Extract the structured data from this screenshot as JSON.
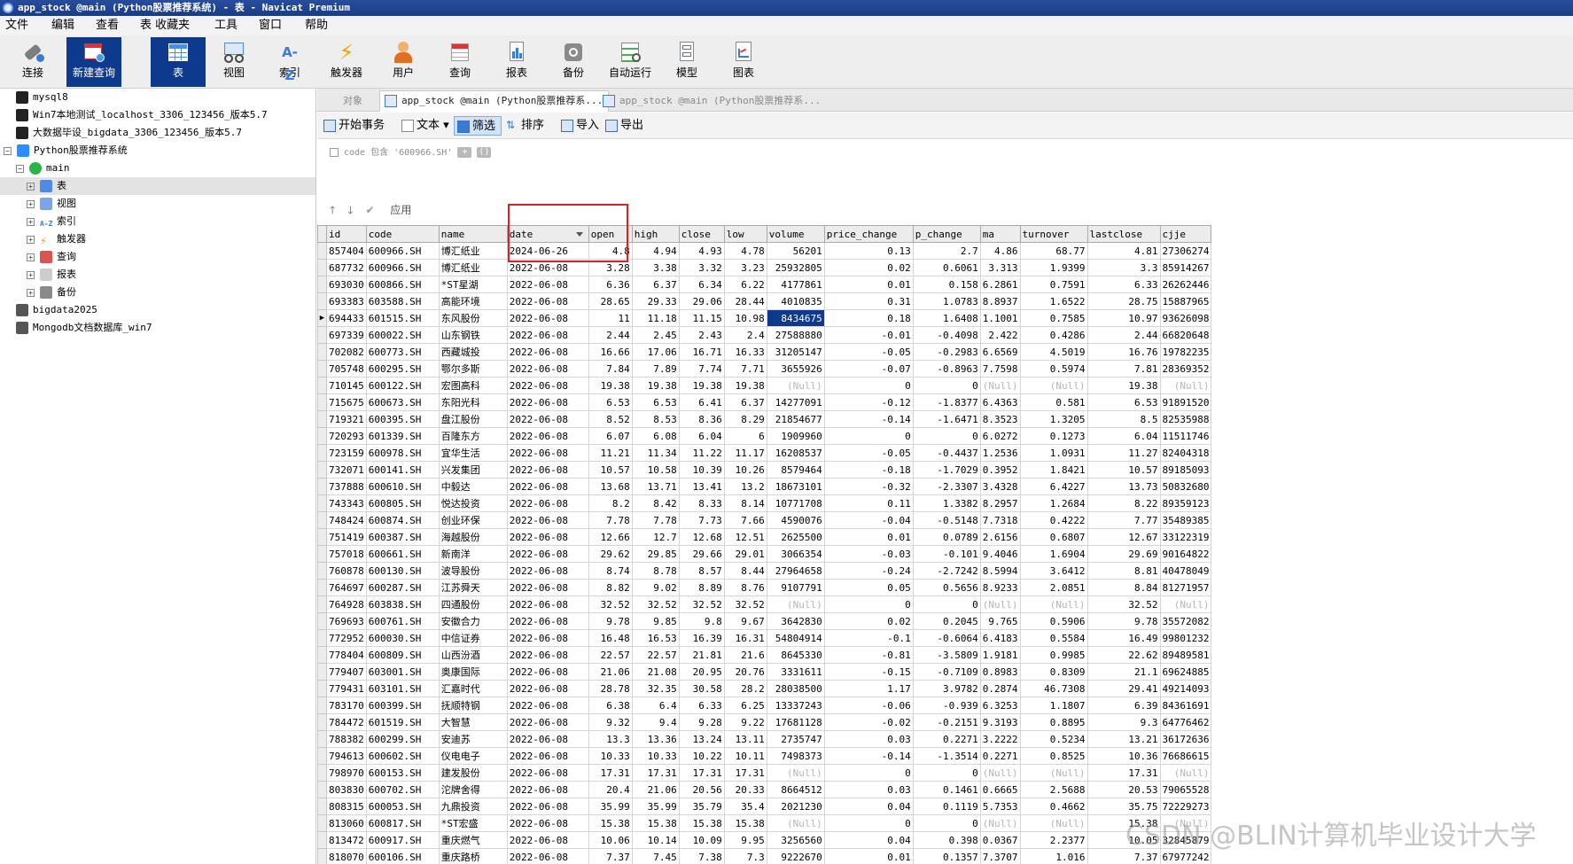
{
  "window": {
    "title": "app_stock @main (Python股票推荐系统) - 表 - Navicat Premium"
  },
  "menu": [
    "文件",
    "编辑",
    "查看",
    "表 收藏夹",
    "工具",
    "窗口",
    "帮助"
  ],
  "toolbar": [
    {
      "label": "连接",
      "icon": "plug-icon"
    },
    {
      "label": "新建查询",
      "icon": "new-query-icon"
    },
    {
      "label": "表",
      "icon": "table-icon"
    },
    {
      "label": "视图",
      "icon": "view-icon"
    },
    {
      "label": "索引",
      "icon": "index-icon"
    },
    {
      "label": "触发器",
      "icon": "lightning-icon"
    },
    {
      "label": "用户",
      "icon": "user-icon"
    },
    {
      "label": "查询",
      "icon": "query-icon"
    },
    {
      "label": "报表",
      "icon": "report-icon"
    },
    {
      "label": "备份",
      "icon": "backup-icon"
    },
    {
      "label": "自动运行",
      "icon": "schedule-icon"
    },
    {
      "label": "模型",
      "icon": "model-icon"
    },
    {
      "label": "图表",
      "icon": "chart-icon"
    }
  ],
  "tree": [
    {
      "label": "mysql8"
    },
    {
      "label": "Win7本地测试_localhost_3306_123456_版本5.7"
    },
    {
      "label": "大数据毕设_bigdata_3306_123456_版本5.7"
    },
    {
      "label": "Python股票推荐系统"
    },
    {
      "label": "main"
    },
    {
      "label": "表"
    },
    {
      "label": "视图"
    },
    {
      "label": "索引"
    },
    {
      "label": "触发器"
    },
    {
      "label": "查询"
    },
    {
      "label": "报表"
    },
    {
      "label": "备份"
    },
    {
      "label": "bigdata2025"
    },
    {
      "label": "Mongodb文档数据库_win7"
    }
  ],
  "tabs": [
    "对象",
    "app_stock @main (Python股票推荐系...",
    "app_stock @main (Python股票推荐系..."
  ],
  "object_toolbar": [
    "开始事务",
    "文本",
    "筛选",
    "排序",
    "导入",
    "导出"
  ],
  "filter": {
    "condition": "code 包含 '600966.SH'",
    "apply": "应用"
  },
  "columns": [
    "id",
    "code",
    "name",
    "date",
    "open",
    "high",
    "close",
    "low",
    "volume",
    "price_change",
    "p_change",
    "ma",
    "turnover",
    "lastclose",
    "cjje"
  ],
  "rows": [
    [
      "857404",
      "600966.SH",
      "博汇纸业",
      "2024-06-26",
      "4.8",
      "4.94",
      "4.93",
      "4.78",
      "56201",
      "0.13",
      "2.7",
      "4.86",
      "68.77",
      "4.81",
      "27306274"
    ],
    [
      "687732",
      "600966.SH",
      "博汇纸业",
      "2022-06-08",
      "3.28",
      "3.38",
      "3.32",
      "3.23",
      "25932805",
      "0.02",
      "0.6061",
      "3.313",
      "1.9399",
      "3.3",
      "85914267"
    ],
    [
      "693030",
      "600866.SH",
      "*ST星湖",
      "2022-06-08",
      "6.36",
      "6.37",
      "6.34",
      "6.22",
      "4177861",
      "0.01",
      "0.158",
      "6.2861",
      "0.7591",
      "6.33",
      "26262446"
    ],
    [
      "693383",
      "603588.SH",
      "高能环境",
      "2022-06-08",
      "28.65",
      "29.33",
      "29.06",
      "28.44",
      "4010835",
      "0.31",
      "1.0783",
      "8.8937",
      "1.6522",
      "28.75",
      "15887965"
    ],
    [
      "694433",
      "601515.SH",
      "东风股份",
      "2022-06-08",
      "11",
      "11.18",
      "11.15",
      "10.98",
      "8434675",
      "0.18",
      "1.6408",
      "1.1001",
      "0.7585",
      "10.97",
      "93626098"
    ],
    [
      "697339",
      "600022.SH",
      "山东钢铁",
      "2022-06-08",
      "2.44",
      "2.45",
      "2.43",
      "2.4",
      "27588880",
      "-0.01",
      "-0.4098",
      "2.422",
      "0.4286",
      "2.44",
      "66820648"
    ],
    [
      "702082",
      "600773.SH",
      "西藏城投",
      "2022-06-08",
      "16.66",
      "17.06",
      "16.71",
      "16.33",
      "31205147",
      "-0.05",
      "-0.2983",
      "6.6569",
      "4.5019",
      "16.76",
      "19782235"
    ],
    [
      "705748",
      "600295.SH",
      "鄂尔多斯",
      "2022-06-08",
      "7.84",
      "7.89",
      "7.74",
      "7.71",
      "3655926",
      "-0.07",
      "-0.8963",
      "7.7598",
      "0.5974",
      "7.81",
      "28369352"
    ],
    [
      "710145",
      "600122.SH",
      "宏图高科",
      "2022-06-08",
      "19.38",
      "19.38",
      "19.38",
      "19.38",
      "(Null)",
      "0",
      "0",
      "(Null)",
      "(Null)",
      "19.38",
      "(Null)"
    ],
    [
      "715675",
      "600673.SH",
      "东阳光科",
      "2022-06-08",
      "6.53",
      "6.53",
      "6.41",
      "6.37",
      "14277091",
      "-0.12",
      "-1.8377",
      "6.4363",
      "0.581",
      "6.53",
      "91891520"
    ],
    [
      "719321",
      "600395.SH",
      "盘江股份",
      "2022-06-08",
      "8.52",
      "8.53",
      "8.36",
      "8.29",
      "21854677",
      "-0.14",
      "-1.6471",
      "8.3523",
      "1.3205",
      "8.5",
      "82535988"
    ],
    [
      "720293",
      "601339.SH",
      "百隆东方",
      "2022-06-08",
      "6.07",
      "6.08",
      "6.04",
      "6",
      "1909960",
      "0",
      "0",
      "6.0272",
      "0.1273",
      "6.04",
      "11511746"
    ],
    [
      "723159",
      "600978.SH",
      "宜华生活",
      "2022-06-08",
      "11.21",
      "11.34",
      "11.22",
      "11.17",
      "16208537",
      "-0.05",
      "-0.4437",
      "1.2536",
      "1.0931",
      "11.27",
      "82404318"
    ],
    [
      "732071",
      "600141.SH",
      "兴发集团",
      "2022-06-08",
      "10.57",
      "10.58",
      "10.39",
      "10.26",
      "8579464",
      "-0.18",
      "-1.7029",
      "0.3952",
      "1.8421",
      "10.57",
      "89185093"
    ],
    [
      "737888",
      "600610.SH",
      "中毅达",
      "2022-06-08",
      "13.68",
      "13.71",
      "13.41",
      "13.2",
      "18673101",
      "-0.32",
      "-2.3307",
      "3.4328",
      "6.4227",
      "13.73",
      "50832680"
    ],
    [
      "743343",
      "600805.SH",
      "悦达投资",
      "2022-06-08",
      "8.2",
      "8.42",
      "8.33",
      "8.14",
      "10771708",
      "0.11",
      "1.3382",
      "8.2957",
      "1.2684",
      "8.22",
      "89359123"
    ],
    [
      "748424",
      "600874.SH",
      "创业环保",
      "2022-06-08",
      "7.78",
      "7.78",
      "7.73",
      "7.66",
      "4590076",
      "-0.04",
      "-0.5148",
      "7.7318",
      "0.4222",
      "7.77",
      "35489385"
    ],
    [
      "751419",
      "600387.SH",
      "海越股份",
      "2022-06-08",
      "12.66",
      "12.7",
      "12.68",
      "12.51",
      "2625500",
      "0.01",
      "0.0789",
      "2.6156",
      "0.6807",
      "12.67",
      "33122319"
    ],
    [
      "757018",
      "600661.SH",
      "新南洋",
      "2022-06-08",
      "29.62",
      "29.85",
      "29.66",
      "29.01",
      "3066354",
      "-0.03",
      "-0.101",
      "9.4046",
      "1.6904",
      "29.69",
      "90164822"
    ],
    [
      "760878",
      "600130.SH",
      "波导股份",
      "2022-06-08",
      "8.74",
      "8.78",
      "8.57",
      "8.44",
      "27964658",
      "-0.24",
      "-2.7242",
      "8.5994",
      "3.6412",
      "8.81",
      "40478049"
    ],
    [
      "764697",
      "600287.SH",
      "江苏舜天",
      "2022-06-08",
      "8.82",
      "9.02",
      "8.89",
      "8.76",
      "9107791",
      "0.05",
      "0.5656",
      "8.9233",
      "2.0851",
      "8.84",
      "81271957"
    ],
    [
      "764928",
      "603838.SH",
      "四通股份",
      "2022-06-08",
      "32.52",
      "32.52",
      "32.52",
      "32.52",
      "(Null)",
      "0",
      "0",
      "(Null)",
      "(Null)",
      "32.52",
      "(Null)"
    ],
    [
      "769693",
      "600761.SH",
      "安徽合力",
      "2022-06-08",
      "9.78",
      "9.85",
      "9.8",
      "9.67",
      "3642830",
      "0.02",
      "0.2045",
      "9.765",
      "0.5906",
      "9.78",
      "35572082"
    ],
    [
      "772952",
      "600030.SH",
      "中信证券",
      "2022-06-08",
      "16.48",
      "16.53",
      "16.39",
      "16.31",
      "54804914",
      "-0.1",
      "-0.6064",
      "6.4183",
      "0.5584",
      "16.49",
      "99801232"
    ],
    [
      "778404",
      "600809.SH",
      "山西汾酒",
      "2022-06-08",
      "22.57",
      "22.57",
      "21.81",
      "21.6",
      "8645330",
      "-0.81",
      "-3.5809",
      "1.9181",
      "0.9985",
      "22.62",
      "89489581"
    ],
    [
      "779407",
      "603001.SH",
      "奥康国际",
      "2022-06-08",
      "21.06",
      "21.08",
      "20.95",
      "20.76",
      "3331611",
      "-0.15",
      "-0.7109",
      "0.8983",
      "0.8309",
      "21.1",
      "69624885"
    ],
    [
      "779431",
      "603101.SH",
      "汇嘉时代",
      "2022-06-08",
      "28.78",
      "32.35",
      "30.58",
      "28.2",
      "28038500",
      "1.17",
      "3.9782",
      "0.2874",
      "46.7308",
      "29.41",
      "49214093"
    ],
    [
      "783170",
      "600399.SH",
      "抚顺特钢",
      "2022-06-08",
      "6.38",
      "6.4",
      "6.33",
      "6.25",
      "13337243",
      "-0.06",
      "-0.939",
      "6.3253",
      "1.1807",
      "6.39",
      "84361691"
    ],
    [
      "784472",
      "601519.SH",
      "大智慧",
      "2022-06-08",
      "9.32",
      "9.4",
      "9.28",
      "9.22",
      "17681128",
      "-0.02",
      "-0.2151",
      "9.3193",
      "0.8895",
      "9.3",
      "64776462"
    ],
    [
      "788382",
      "600299.SH",
      "安迪苏",
      "2022-06-08",
      "13.3",
      "13.36",
      "13.24",
      "13.11",
      "2735747",
      "0.03",
      "0.2271",
      "3.2222",
      "0.5234",
      "13.21",
      "36172636"
    ],
    [
      "794613",
      "600602.SH",
      "仪电电子",
      "2022-06-08",
      "10.33",
      "10.33",
      "10.22",
      "10.11",
      "7498373",
      "-0.14",
      "-1.3514",
      "0.2271",
      "0.8525",
      "10.36",
      "76686615"
    ],
    [
      "798970",
      "600153.SH",
      "建发股份",
      "2022-06-08",
      "17.31",
      "17.31",
      "17.31",
      "17.31",
      "(Null)",
      "0",
      "0",
      "(Null)",
      "(Null)",
      "17.31",
      "(Null)"
    ],
    [
      "803830",
      "600702.SH",
      "沱牌舍得",
      "2022-06-08",
      "20.4",
      "21.06",
      "20.56",
      "20.33",
      "8664512",
      "0.03",
      "0.1461",
      "0.6665",
      "2.5688",
      "20.53",
      "79065528"
    ],
    [
      "808315",
      "600053.SH",
      "九鼎投资",
      "2022-06-08",
      "35.99",
      "35.99",
      "35.79",
      "35.4",
      "2021230",
      "0.04",
      "0.1119",
      "5.7353",
      "0.4662",
      "35.75",
      "72229273"
    ],
    [
      "813060",
      "600817.SH",
      "*ST宏盛",
      "2022-06-08",
      "15.38",
      "15.38",
      "15.38",
      "15.38",
      "(Null)",
      "0",
      "0",
      "(Null)",
      "(Null)",
      "15.38",
      "(Null)"
    ],
    [
      "813472",
      "600917.SH",
      "重庆燃气",
      "2022-06-08",
      "10.06",
      "10.14",
      "10.09",
      "9.95",
      "3256560",
      "0.04",
      "0.398",
      "0.0367",
      "2.2377",
      "10.05",
      "32845879"
    ],
    [
      "818070",
      "600106.SH",
      "重庆路桥",
      "2022-06-08",
      "7.37",
      "7.45",
      "7.38",
      "7.3",
      "9222670",
      "0.01",
      "0.1357",
      "7.3707",
      "1.016",
      "7.37",
      "67977242"
    ]
  ],
  "selected": {
    "row": 4,
    "col": 8
  },
  "watermark": "CSDN @BLIN计算机毕业设计大学"
}
